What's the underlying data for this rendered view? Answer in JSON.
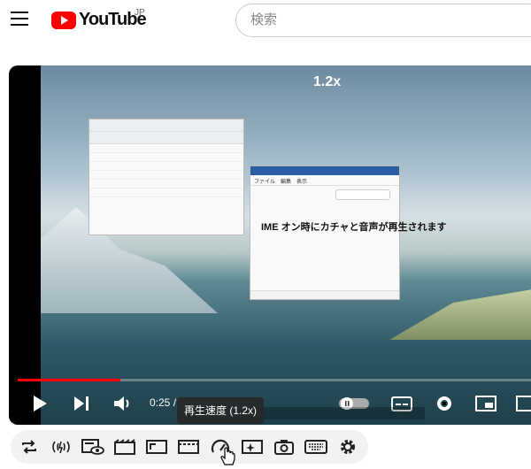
{
  "header": {
    "logo_text": "YouTube",
    "region": "JP",
    "search_placeholder": "検索"
  },
  "player": {
    "speed_overlay": "1.2x",
    "time": "0:25 /",
    "progress_fraction": 0.2,
    "notepad": {
      "menu": "ファイル　編集　表示",
      "text": "IME オン時にカチャと音声が再生されます"
    }
  },
  "tooltip": "再生速度 (1.2x)",
  "toolbar": {
    "icons": [
      "repeat-icon",
      "audio-icon",
      "eye-icon",
      "cinema-icon",
      "crop-icon",
      "frame-icon",
      "speed-icon",
      "sparkle-icon",
      "camera-icon",
      "keyboard-icon",
      "settings-icon"
    ]
  },
  "colors": {
    "brand": "#ff0000",
    "accent_progress": "#ff0000"
  }
}
